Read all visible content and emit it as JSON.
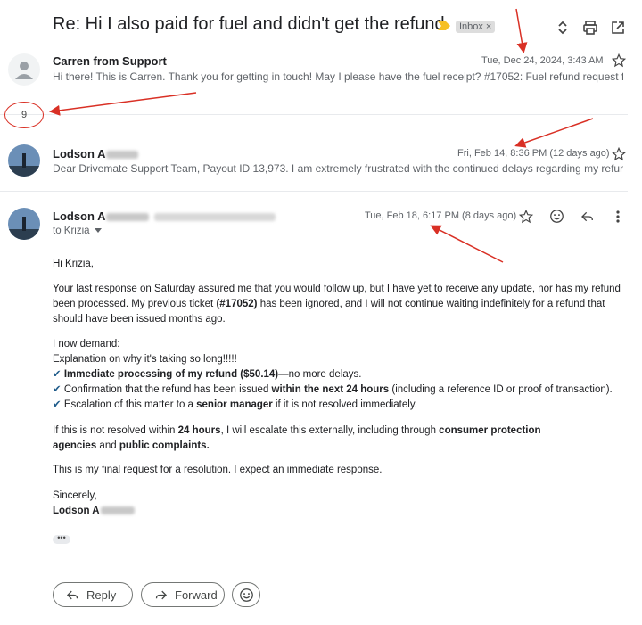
{
  "subject": "Re: Hi I also paid for fuel and didn't get the refund",
  "label_chip": "Inbox",
  "label_chip_close": "×",
  "collapsed_count": "9",
  "messages": [
    {
      "sender": "Carren from Support",
      "date": "Tue, Dec 24, 2024, 3:43 AM",
      "snippet": "Hi there! This is Carren. Thank you for getting in touch! May I please have the fuel receipt? #17052: Fuel refund request for TA..."
    },
    {
      "sender": "Lodson A",
      "date": "Fri, Feb 14, 8:36 PM (12 days ago)",
      "snippet": "Dear Drivemate Support Team, Payout ID 13,973. I am extremely frustrated with the continued delays regarding my refund of ..."
    },
    {
      "sender": "Lodson A",
      "date": "Tue, Feb 18, 6:17 PM (8 days ago)",
      "to_line": "to Krizia",
      "greeting": "Hi Krizia,",
      "para1_a": "Your last response on Saturday assured me that you would follow up, but I have yet to receive any update, nor has my refund been processed. My previous ticket ",
      "para1_ticket": "(#17052)",
      "para1_b": " has been ignored, and I will not continue waiting indefinitely for a refund that should have been issued months ago.",
      "demand_intro": "I now demand:",
      "demand_line": "Explanation on why it's taking so long!!!!!",
      "check1_bold": "Immediate processing of my refund ($50.14)",
      "check1_rest": "—no more delays.",
      "check2_a": "Confirmation that the refund has been issued ",
      "check2_bold": "within the next 24 hours",
      "check2_b": " (including a reference ID or proof of transaction).",
      "check3_a": "Escalation of this matter to a ",
      "check3_bold": "senior manager",
      "check3_b": " if it is not resolved immediately.",
      "para3_a": "If this is not resolved within ",
      "para3_bold1": "24 hours",
      "para3_b": ", I will escalate this externally, including through ",
      "para3_bold2": "consumer protection agencies",
      "para3_c": " and ",
      "para3_bold3": "public complaints.",
      "para4": "This is my final request for a resolution. I expect an immediate response.",
      "signoff": "Sincerely,",
      "signature": "Lodson A"
    }
  ],
  "check_glyph": "✔",
  "reply_label": "Reply",
  "forward_label": "Forward",
  "colors": {
    "annotation": "#d93025",
    "checkmark": "#1e5b8a"
  }
}
